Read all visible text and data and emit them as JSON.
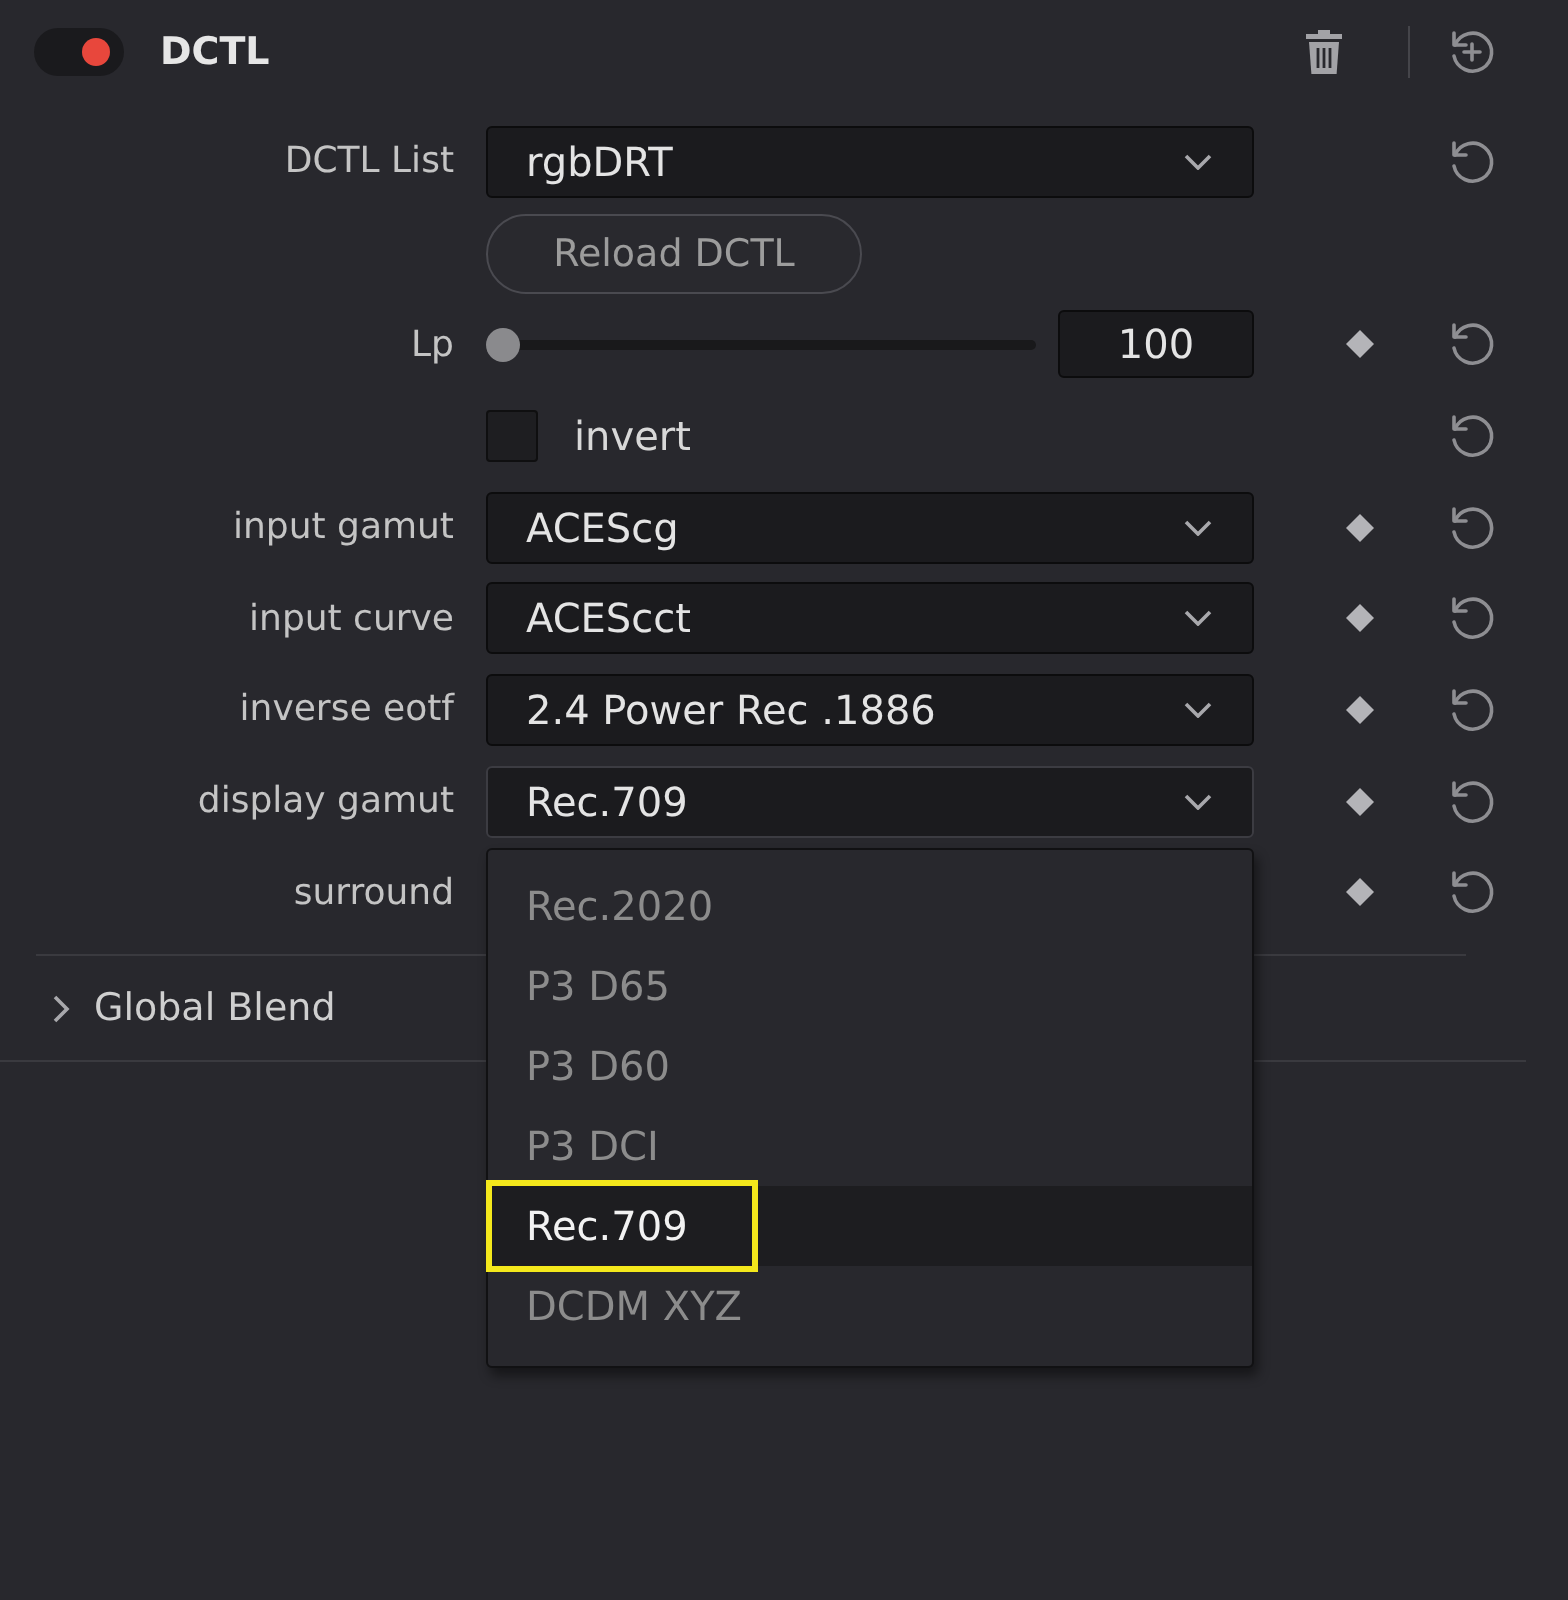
{
  "panel": {
    "title": "DCTL",
    "enabled": true
  },
  "rows": [
    {
      "kind": "dropdown",
      "label": "DCTL List",
      "value": "rgbDRT",
      "keyframe": false,
      "reset": true
    },
    {
      "kind": "button",
      "text": "Reload DCTL",
      "keyframe": false,
      "reset": false
    },
    {
      "kind": "slider",
      "label": "Lp",
      "level": 0,
      "value": "100",
      "keyframe": true,
      "reset": true
    },
    {
      "kind": "checkbox",
      "text": "invert",
      "checked": false,
      "keyframe": false,
      "reset": true
    },
    {
      "kind": "dropdown",
      "label": "input gamut",
      "value": "ACEScg",
      "keyframe": true,
      "reset": true
    },
    {
      "kind": "dropdown",
      "label": "input curve",
      "value": "ACEScct",
      "keyframe": true,
      "reset": true
    },
    {
      "kind": "dropdown",
      "label": "inverse eotf",
      "value": "2.4 Power Rec .1886",
      "keyframe": true,
      "reset": true
    },
    {
      "kind": "dropdown",
      "label": "display gamut",
      "value": "Rec.709",
      "expanded": true,
      "keyframe": true,
      "reset": true,
      "options": [
        {
          "label": "Rec.2020",
          "selected": false,
          "outlined": false
        },
        {
          "label": "P3 D65",
          "selected": false,
          "outlined": false
        },
        {
          "label": "P3 D60",
          "selected": false,
          "outlined": false
        },
        {
          "label": "P3 DCI",
          "selected": false,
          "outlined": false
        },
        {
          "label": "Rec.709",
          "selected": true,
          "outlined": true
        },
        {
          "label": "DCDM XYZ",
          "selected": false,
          "outlined": false
        }
      ]
    },
    {
      "kind": "dropdown",
      "label": "surround",
      "keyframe": true,
      "reset": true
    }
  ],
  "sections": [
    {
      "title": "Global Blend",
      "expanded": false
    }
  ]
}
